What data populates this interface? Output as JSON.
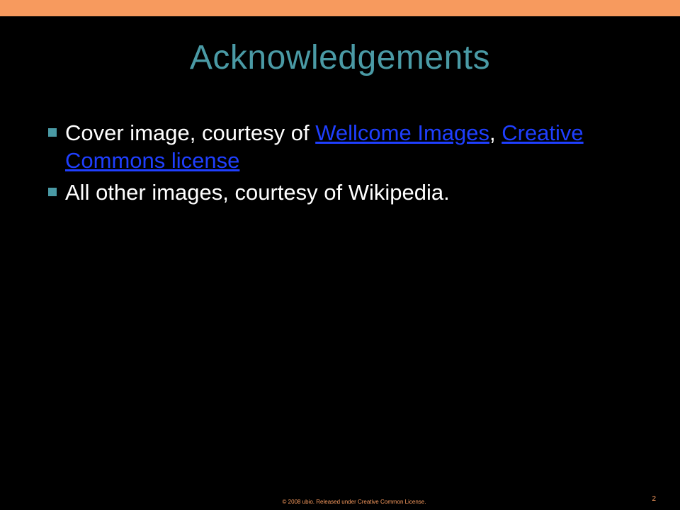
{
  "slide": {
    "title": "Acknowledgements",
    "bullets": [
      {
        "text_before": "Cover image, courtesy of ",
        "link1": "Wellcome Images",
        "text_middle": ", ",
        "link2": "Creative Commons license"
      },
      {
        "text": "All other images, courtesy of Wikipedia."
      }
    ],
    "footer": "© 2008 ubio. Released under Creative Common License.",
    "page_number": "2"
  },
  "colors": {
    "background": "#000000",
    "top_bar": "#f79a5e",
    "title": "#4a9aa5",
    "bullet_marker": "#4a9aa5",
    "body_text": "#ffffff",
    "link": "#1f3fff",
    "footer": "#f79a5e"
  }
}
